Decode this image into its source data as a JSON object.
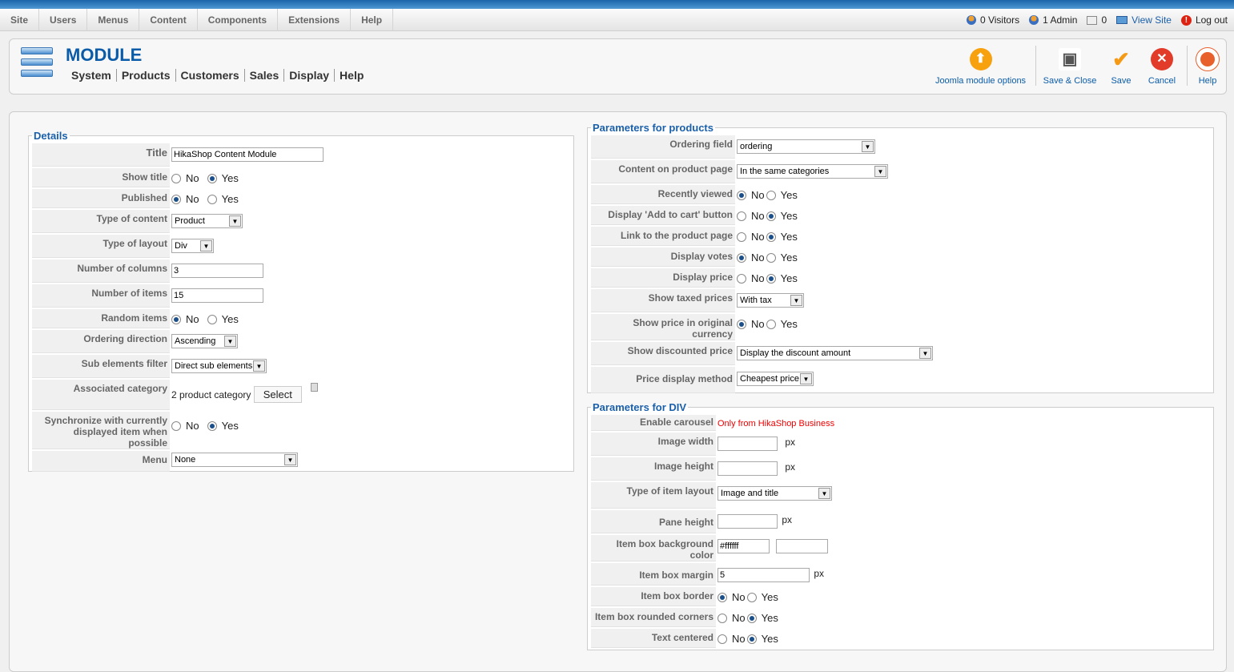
{
  "top_menu": [
    "Site",
    "Users",
    "Menus",
    "Content",
    "Components",
    "Extensions",
    "Help"
  ],
  "status": {
    "visitors": "0 Visitors",
    "admins": "1 Admin",
    "messages": "0",
    "view_site": "View Site",
    "logout": "Log out"
  },
  "page_title": "MODULE",
  "submenu": [
    "System",
    "Products",
    "Customers",
    "Sales",
    "Display",
    "Help"
  ],
  "toolbar": {
    "joomla_options": "Joomla module options",
    "save_close": "Save & Close",
    "save": "Save",
    "cancel": "Cancel",
    "help": "Help"
  },
  "details": {
    "legend": "Details",
    "title_label": "Title",
    "title_value": "HikaShop Content Module",
    "show_title_label": "Show title",
    "published_label": "Published",
    "type_content_label": "Type of content",
    "type_content_value": "Product",
    "type_layout_label": "Type of layout",
    "type_layout_value": "Div",
    "columns_label": "Number of columns",
    "columns_value": "3",
    "items_label": "Number of items",
    "items_value": "15",
    "random_label": "Random items",
    "ordering_dir_label": "Ordering direction",
    "ordering_dir_value": "Ascending",
    "sub_filter_label": "Sub elements filter",
    "sub_filter_value": "Direct sub elements",
    "assoc_cat_label": "Associated category",
    "assoc_cat_value": "2 product category",
    "select_btn": "Select",
    "sync_label_1": "Synchronize with currently",
    "sync_label_2": "displayed item when possible",
    "menu_label": "Menu",
    "menu_value": "None"
  },
  "products": {
    "legend": "Parameters for products",
    "ordering_field_label": "Ordering field",
    "ordering_field_value": "ordering",
    "content_page_label": "Content on product page",
    "content_page_value": "In the same categories",
    "recently_label": "Recently viewed",
    "add_cart_label": "Display 'Add to cart' button",
    "link_label": "Link to the product page",
    "votes_label": "Display votes",
    "price_label": "Display price",
    "taxed_label": "Show taxed prices",
    "taxed_value": "With tax",
    "orig_currency_label": "Show price in original currency",
    "discounted_label": "Show discounted price",
    "discounted_value": "Display the discount amount",
    "price_method_label": "Price display method",
    "price_method_value": "Cheapest price"
  },
  "div": {
    "legend": "Parameters for DIV",
    "carousel_label": "Enable carousel",
    "carousel_value": "Only from HikaShop Business",
    "img_width_label": "Image width",
    "img_height_label": "Image height",
    "item_layout_label": "Type of item layout",
    "item_layout_value": "Image and title",
    "pane_height_label": "Pane height",
    "bg_color_label": "Item box background color",
    "bg_color_value": "#ffffff",
    "margin_label": "Item box margin",
    "margin_value": "5",
    "border_label": "Item box border",
    "rounded_label": "Item box rounded corners",
    "centered_label": "Text centered"
  },
  "common": {
    "no": "No",
    "yes": "Yes",
    "px": "px"
  }
}
